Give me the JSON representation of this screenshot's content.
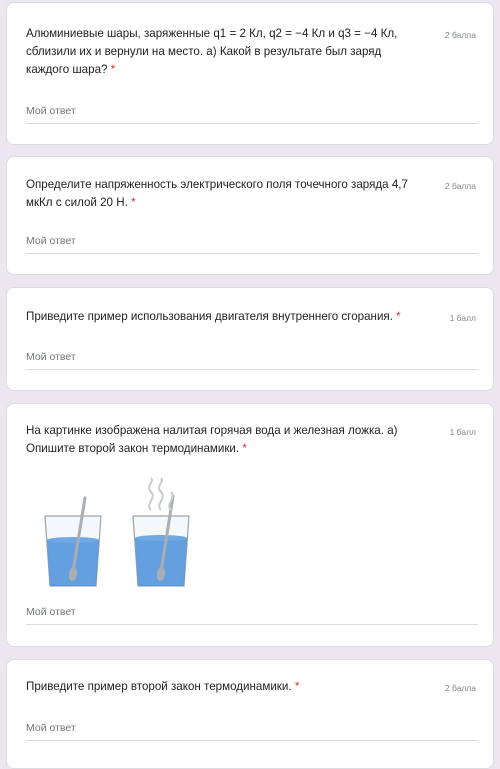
{
  "questions": [
    {
      "title": "Алюминиевые шары, заряженные q1 = 2 Кл, q2 = −4 Кл и q3 = −4 Кл, сблизили их и вернули на место. а) Какой в результате был заряд каждого шара?",
      "required_mark": "*",
      "points": "2 балла",
      "answer_placeholder": "Мой ответ"
    },
    {
      "title": "Определите напряженность электрического поля точечного заряда 4,7 мкКл с силой 20 Н.",
      "required_mark": "*",
      "points": "2 балла",
      "answer_placeholder": "Мой ответ"
    },
    {
      "title": "Приведите пример использования двигателя внутреннего сгорания.",
      "required_mark": "*",
      "points": "1 балл",
      "answer_placeholder": "Мой ответ"
    },
    {
      "title": "На картинке изображена налитая горячая вода и железная ложка. а) Опишите второй закон термодинамики.",
      "required_mark": "*",
      "points": "1 балл",
      "answer_placeholder": "Мой ответ"
    },
    {
      "title": "Приведите пример второй закон термодинамики.",
      "required_mark": "*",
      "points": "2 балла",
      "answer_placeholder": "Мой ответ"
    }
  ],
  "colors": {
    "background": "#ece6f1",
    "card": "#ffffff",
    "required": "#d93025",
    "water": "#4a90d9"
  }
}
